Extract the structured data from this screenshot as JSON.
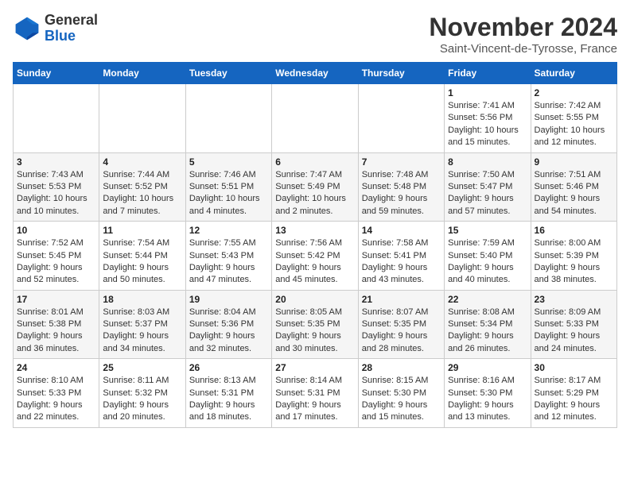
{
  "header": {
    "logo": {
      "general": "General",
      "blue": "Blue"
    },
    "title": "November 2024",
    "location": "Saint-Vincent-de-Tyrosse, France"
  },
  "weekdays": [
    "Sunday",
    "Monday",
    "Tuesday",
    "Wednesday",
    "Thursday",
    "Friday",
    "Saturday"
  ],
  "weeks": [
    [
      {
        "day": "",
        "info": ""
      },
      {
        "day": "",
        "info": ""
      },
      {
        "day": "",
        "info": ""
      },
      {
        "day": "",
        "info": ""
      },
      {
        "day": "",
        "info": ""
      },
      {
        "day": "1",
        "info": "Sunrise: 7:41 AM\nSunset: 5:56 PM\nDaylight: 10 hours and 15 minutes."
      },
      {
        "day": "2",
        "info": "Sunrise: 7:42 AM\nSunset: 5:55 PM\nDaylight: 10 hours and 12 minutes."
      }
    ],
    [
      {
        "day": "3",
        "info": "Sunrise: 7:43 AM\nSunset: 5:53 PM\nDaylight: 10 hours and 10 minutes."
      },
      {
        "day": "4",
        "info": "Sunrise: 7:44 AM\nSunset: 5:52 PM\nDaylight: 10 hours and 7 minutes."
      },
      {
        "day": "5",
        "info": "Sunrise: 7:46 AM\nSunset: 5:51 PM\nDaylight: 10 hours and 4 minutes."
      },
      {
        "day": "6",
        "info": "Sunrise: 7:47 AM\nSunset: 5:49 PM\nDaylight: 10 hours and 2 minutes."
      },
      {
        "day": "7",
        "info": "Sunrise: 7:48 AM\nSunset: 5:48 PM\nDaylight: 9 hours and 59 minutes."
      },
      {
        "day": "8",
        "info": "Sunrise: 7:50 AM\nSunset: 5:47 PM\nDaylight: 9 hours and 57 minutes."
      },
      {
        "day": "9",
        "info": "Sunrise: 7:51 AM\nSunset: 5:46 PM\nDaylight: 9 hours and 54 minutes."
      }
    ],
    [
      {
        "day": "10",
        "info": "Sunrise: 7:52 AM\nSunset: 5:45 PM\nDaylight: 9 hours and 52 minutes."
      },
      {
        "day": "11",
        "info": "Sunrise: 7:54 AM\nSunset: 5:44 PM\nDaylight: 9 hours and 50 minutes."
      },
      {
        "day": "12",
        "info": "Sunrise: 7:55 AM\nSunset: 5:43 PM\nDaylight: 9 hours and 47 minutes."
      },
      {
        "day": "13",
        "info": "Sunrise: 7:56 AM\nSunset: 5:42 PM\nDaylight: 9 hours and 45 minutes."
      },
      {
        "day": "14",
        "info": "Sunrise: 7:58 AM\nSunset: 5:41 PM\nDaylight: 9 hours and 43 minutes."
      },
      {
        "day": "15",
        "info": "Sunrise: 7:59 AM\nSunset: 5:40 PM\nDaylight: 9 hours and 40 minutes."
      },
      {
        "day": "16",
        "info": "Sunrise: 8:00 AM\nSunset: 5:39 PM\nDaylight: 9 hours and 38 minutes."
      }
    ],
    [
      {
        "day": "17",
        "info": "Sunrise: 8:01 AM\nSunset: 5:38 PM\nDaylight: 9 hours and 36 minutes."
      },
      {
        "day": "18",
        "info": "Sunrise: 8:03 AM\nSunset: 5:37 PM\nDaylight: 9 hours and 34 minutes."
      },
      {
        "day": "19",
        "info": "Sunrise: 8:04 AM\nSunset: 5:36 PM\nDaylight: 9 hours and 32 minutes."
      },
      {
        "day": "20",
        "info": "Sunrise: 8:05 AM\nSunset: 5:35 PM\nDaylight: 9 hours and 30 minutes."
      },
      {
        "day": "21",
        "info": "Sunrise: 8:07 AM\nSunset: 5:35 PM\nDaylight: 9 hours and 28 minutes."
      },
      {
        "day": "22",
        "info": "Sunrise: 8:08 AM\nSunset: 5:34 PM\nDaylight: 9 hours and 26 minutes."
      },
      {
        "day": "23",
        "info": "Sunrise: 8:09 AM\nSunset: 5:33 PM\nDaylight: 9 hours and 24 minutes."
      }
    ],
    [
      {
        "day": "24",
        "info": "Sunrise: 8:10 AM\nSunset: 5:33 PM\nDaylight: 9 hours and 22 minutes."
      },
      {
        "day": "25",
        "info": "Sunrise: 8:11 AM\nSunset: 5:32 PM\nDaylight: 9 hours and 20 minutes."
      },
      {
        "day": "26",
        "info": "Sunrise: 8:13 AM\nSunset: 5:31 PM\nDaylight: 9 hours and 18 minutes."
      },
      {
        "day": "27",
        "info": "Sunrise: 8:14 AM\nSunset: 5:31 PM\nDaylight: 9 hours and 17 minutes."
      },
      {
        "day": "28",
        "info": "Sunrise: 8:15 AM\nSunset: 5:30 PM\nDaylight: 9 hours and 15 minutes."
      },
      {
        "day": "29",
        "info": "Sunrise: 8:16 AM\nSunset: 5:30 PM\nDaylight: 9 hours and 13 minutes."
      },
      {
        "day": "30",
        "info": "Sunrise: 8:17 AM\nSunset: 5:29 PM\nDaylight: 9 hours and 12 minutes."
      }
    ]
  ]
}
